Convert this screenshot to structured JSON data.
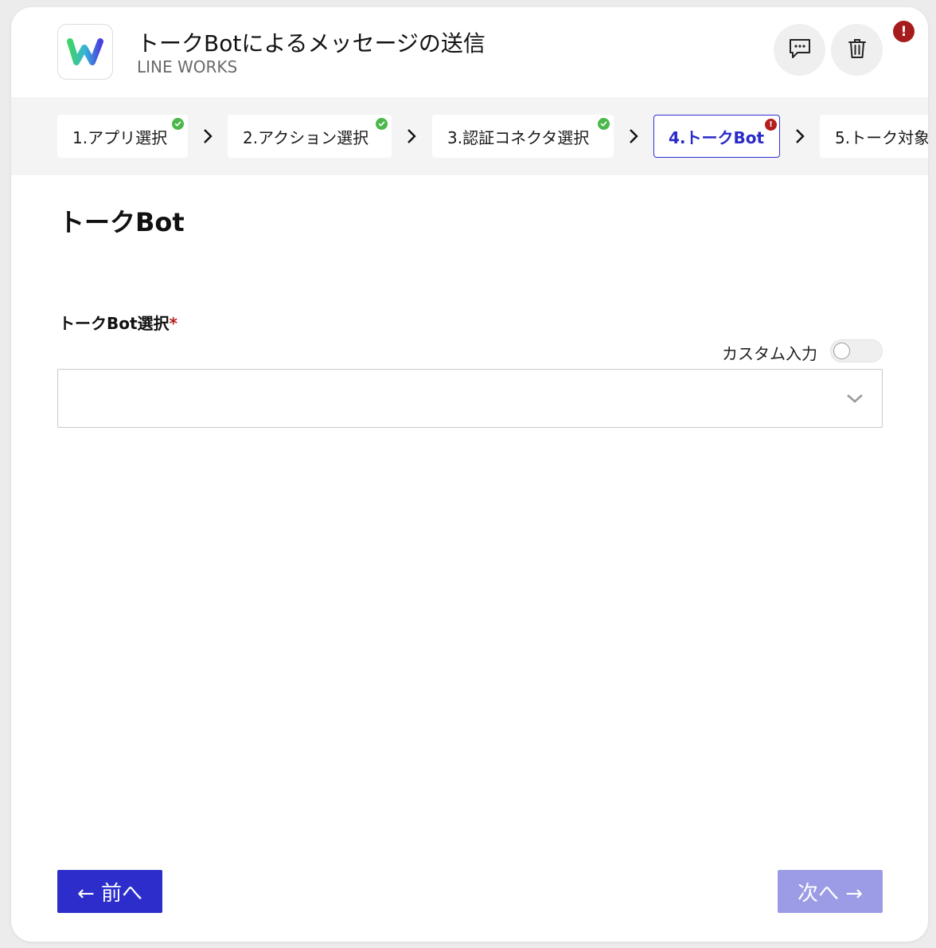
{
  "header": {
    "title": "トークBotによるメッセージの送信",
    "subtitle": "LINE WORKS",
    "alert_badge": "!",
    "icons": {
      "app": "line-works-logo",
      "comment": "comment-icon",
      "delete": "trash-icon"
    }
  },
  "stepper": {
    "steps": [
      {
        "label": "1.アプリ選択",
        "status": "complete"
      },
      {
        "label": "2.アクション選択",
        "status": "complete"
      },
      {
        "label": "3.認証コネクタ選択",
        "status": "complete"
      },
      {
        "label": "4.トークBot",
        "status": "error",
        "active": true
      },
      {
        "label": "5.トーク対象",
        "status": "pending"
      }
    ],
    "error_mark": "!"
  },
  "main": {
    "section_title": "トークBot",
    "field_label": "トークBot選択",
    "required_mark": "*",
    "custom_input_label": "カスタム入力",
    "custom_input_enabled": false,
    "select_value": ""
  },
  "footer": {
    "prev_label": "← 前へ",
    "next_label": "次へ →"
  },
  "colors": {
    "accent": "#2d2dcc",
    "accent_disabled": "#9c9ce6",
    "success": "#4cb84c",
    "error": "#b31d1d"
  }
}
